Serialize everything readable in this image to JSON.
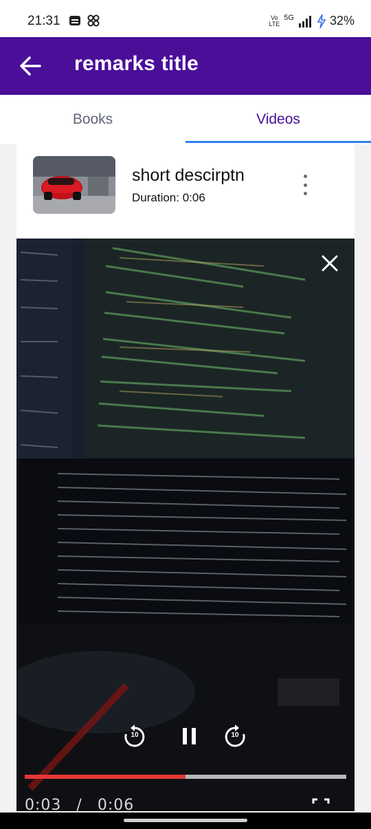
{
  "status_bar": {
    "time": "21:31",
    "network": "5G",
    "battery": "32%"
  },
  "app_bar": {
    "title": "remarks title"
  },
  "tabs": [
    {
      "label": "Books",
      "selected": false
    },
    {
      "label": "Videos",
      "selected": true
    }
  ],
  "item": {
    "title": "short descirptn",
    "duration": "Duration: 0:06"
  },
  "player": {
    "current_time": "0:03",
    "separator": "/",
    "total_time": "0:06",
    "progress": 0.5,
    "skip_seconds": "10"
  },
  "colors": {
    "app_bar": "#4a0e99",
    "tab_active": "#4a0e99",
    "indicator": "#2f80ed",
    "progress": "#e53935"
  }
}
